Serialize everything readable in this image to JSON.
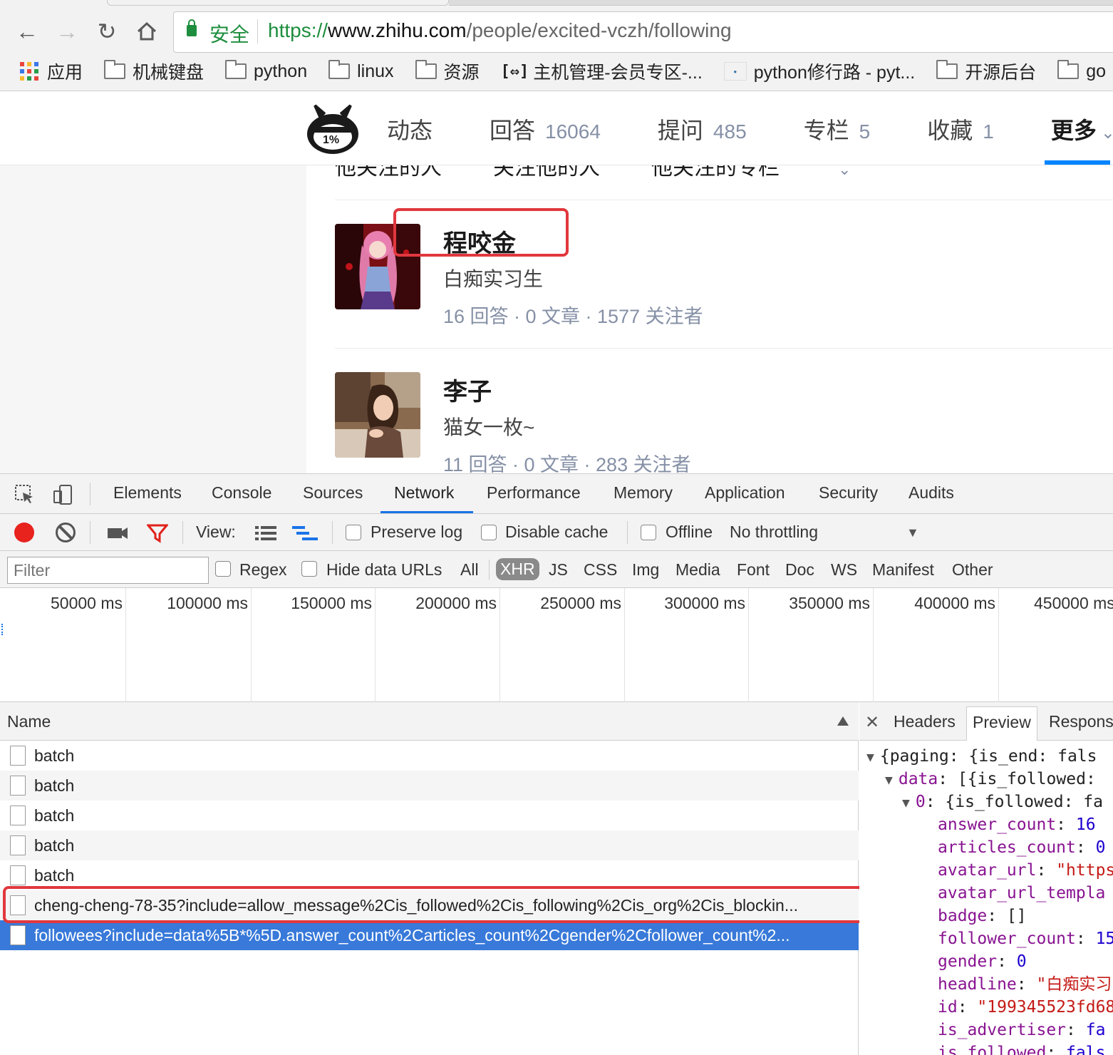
{
  "browser": {
    "secure_label": "安全",
    "url_scheme": "https://",
    "url_host": "www.zhihu.com",
    "url_path": "/people/excited-vczh/following",
    "bookmarks": [
      {
        "label": "应用",
        "icon": "apps-grid-icon"
      },
      {
        "label": "机械键盘",
        "icon": "folder-icon"
      },
      {
        "label": "python",
        "icon": "folder-icon"
      },
      {
        "label": "linux",
        "icon": "folder-icon"
      },
      {
        "label": "资源",
        "icon": "folder-icon"
      },
      {
        "label": "主机管理-会员专区-...",
        "icon": "host-icon"
      },
      {
        "label": "python修行路 - pyt...",
        "icon": "python-icon"
      },
      {
        "label": "开源后台",
        "icon": "folder-icon"
      },
      {
        "label": "go",
        "icon": "folder-icon"
      }
    ]
  },
  "zhihu": {
    "logo_text": "1%",
    "nav": [
      {
        "label": "动态",
        "count": ""
      },
      {
        "label": "回答",
        "count": "16064"
      },
      {
        "label": "提问",
        "count": "485"
      },
      {
        "label": "专栏",
        "count": "5"
      },
      {
        "label": "收藏",
        "count": "1"
      },
      {
        "label": "更多",
        "count": ""
      }
    ],
    "subtabs": [
      "他关注的人",
      "关注他的人",
      "他关注的专栏"
    ],
    "users": [
      {
        "name": "程咬金",
        "headline": "白痴实习生",
        "stats": "16 回答 · 0 文章 · 1577 关注者"
      },
      {
        "name": "李子",
        "headline": "猫女一枚~",
        "stats": "11 回答 · 0 文章 · 283 关注者"
      }
    ]
  },
  "devtools": {
    "tabs": [
      "Elements",
      "Console",
      "Sources",
      "Network",
      "Performance",
      "Memory",
      "Application",
      "Security",
      "Audits"
    ],
    "active_tab": "Network",
    "toolbar": {
      "view_label": "View:",
      "preserve_log": "Preserve log",
      "disable_cache": "Disable cache",
      "offline": "Offline",
      "throttling": "No throttling"
    },
    "filter": {
      "placeholder": "Filter",
      "regex": "Regex",
      "hide_data_urls": "Hide data URLs",
      "types": [
        "All",
        "XHR",
        "JS",
        "CSS",
        "Img",
        "Media",
        "Font",
        "Doc",
        "WS",
        "Manifest",
        "Other"
      ],
      "selected_type": "XHR"
    },
    "timeline_ticks": [
      "50000 ms",
      "100000 ms",
      "150000 ms",
      "200000 ms",
      "250000 ms",
      "300000 ms",
      "350000 ms",
      "400000 ms",
      "450000 ms"
    ],
    "requests_header": "Name",
    "requests": [
      "batch",
      "batch",
      "batch",
      "batch",
      "batch",
      "cheng-cheng-78-35?include=allow_message%2Cis_followed%2Cis_following%2Cis_org%2Cis_blockin...",
      "followees?include=data%5B*%5D.answer_count%2Carticles_count%2Cgender%2Cfollower_count%2..."
    ],
    "detail_tabs": [
      "Headers",
      "Preview",
      "Respons"
    ],
    "active_detail_tab": "Preview",
    "preview": {
      "l0": "{paging: {is_end: fals",
      "l1_key": "data",
      "l1_val": "[{is_followed:",
      "l2_key": "0",
      "l2_val": "{is_followed: fa",
      "answer_count_key": "answer_count",
      "answer_count_val": "16",
      "articles_count_key": "articles_count",
      "articles_count_val": "0",
      "avatar_url_key": "avatar_url",
      "avatar_url_val": "\"https",
      "avatar_url_template_key": "avatar_url_templa",
      "badge_key": "badge",
      "badge_val": "[]",
      "follower_count_key": "follower_count",
      "follower_count_val": "15",
      "gender_key": "gender",
      "gender_val": "0",
      "headline_key": "headline",
      "headline_val": "\"白痴实习",
      "id_key": "id",
      "id_val": "\"199345523fd68",
      "is_advertiser_key": "is_advertiser",
      "is_advertiser_val": "fa",
      "is_followed_key": "is_followed",
      "is_followed_val": "fals"
    }
  },
  "colors": {
    "secure_green": "#1e8e3e",
    "zhihu_blue": "#0084ff",
    "highlight_red": "#e0383e",
    "selected_row": "#3879d9"
  }
}
